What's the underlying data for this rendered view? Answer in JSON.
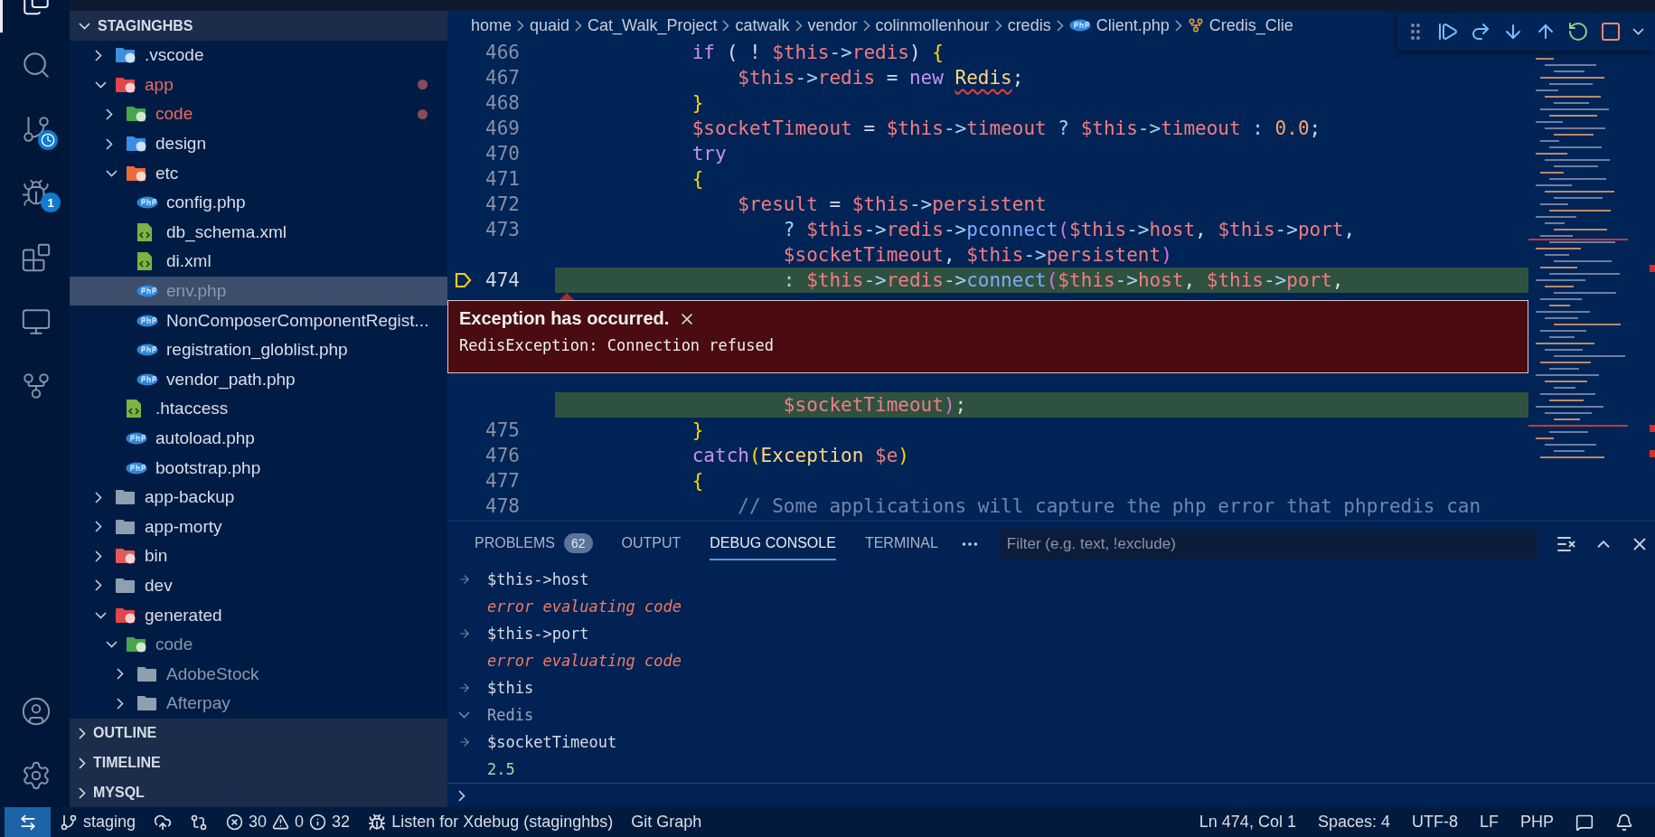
{
  "activity_bar": {
    "items": [
      {
        "kind": "explorer",
        "selected": true
      },
      {
        "kind": "search",
        "selected": false
      },
      {
        "kind": "source-control",
        "selected": false
      },
      {
        "kind": "run-debug",
        "selected": false,
        "badge": "1"
      },
      {
        "kind": "extensions",
        "selected": false
      },
      {
        "kind": "remote-explorer",
        "selected": false
      },
      {
        "kind": "git-graph",
        "selected": false
      }
    ],
    "bottom": [
      {
        "kind": "account"
      },
      {
        "kind": "settings"
      }
    ]
  },
  "sidebar": {
    "title": "STAGINGHBS",
    "expanded": true,
    "tree": [
      {
        "name": ".vscode",
        "kind": "folder-vscode",
        "expanded": false,
        "selected": false
      },
      {
        "name": "app",
        "kind": "folder-app",
        "expanded": true,
        "selected": false,
        "modified": true,
        "children": [
          {
            "name": "code",
            "kind": "folder-code",
            "expanded": false,
            "selected": false,
            "modified": true
          },
          {
            "name": "design",
            "kind": "folder-design",
            "expanded": false,
            "selected": false
          },
          {
            "name": "etc",
            "kind": "folder-config",
            "expanded": true,
            "selected": false,
            "children": [
              {
                "name": "config.php",
                "kind": "php",
                "selected": false
              },
              {
                "name": "db_schema.xml",
                "kind": "xml",
                "selected": false
              },
              {
                "name": "di.xml",
                "kind": "xml",
                "selected": false
              },
              {
                "name": "env.php",
                "kind": "php",
                "selected": true,
                "ignored": true
              },
              {
                "name": "NonComposerComponentRegist...",
                "kind": "php",
                "selected": false
              },
              {
                "name": "registration_globlist.php",
                "kind": "php",
                "selected": false
              },
              {
                "name": "vendor_path.php",
                "kind": "php",
                "selected": false
              }
            ]
          },
          {
            "name": ".htaccess",
            "kind": "xml",
            "selected": false
          },
          {
            "name": "autoload.php",
            "kind": "php",
            "selected": false
          },
          {
            "name": "bootstrap.php",
            "kind": "php",
            "selected": false
          }
        ]
      },
      {
        "name": "app-backup",
        "kind": "folder",
        "expanded": false,
        "selected": false
      },
      {
        "name": "app-morty",
        "kind": "folder",
        "expanded": false,
        "selected": false
      },
      {
        "name": "bin",
        "kind": "folder-bin",
        "expanded": false,
        "selected": false
      },
      {
        "name": "dev",
        "kind": "folder",
        "expanded": false,
        "selected": false
      },
      {
        "name": "generated",
        "kind": "folder-generated",
        "expanded": true,
        "selected": false,
        "children": [
          {
            "name": "code",
            "kind": "folder-code",
            "expanded": true,
            "selected": false,
            "ignored": true,
            "children": [
              {
                "name": "AdobeStock",
                "kind": "folder",
                "expanded": false,
                "selected": false,
                "ignored": true
              },
              {
                "name": "Afterpay",
                "kind": "folder",
                "expanded": false,
                "selected": false,
                "ignored": true
              }
            ]
          }
        ]
      }
    ],
    "sections": [
      {
        "title": "OUTLINE",
        "expanded": false
      },
      {
        "title": "TIMELINE",
        "expanded": false
      },
      {
        "title": "MYSQL",
        "expanded": false
      }
    ]
  },
  "editor": {
    "breadcrumbs": [
      {
        "label": "home"
      },
      {
        "label": "quaid"
      },
      {
        "label": "Cat_Walk_Project"
      },
      {
        "label": "catwalk"
      },
      {
        "label": "vendor"
      },
      {
        "label": "colinmollenhour"
      },
      {
        "label": "credis"
      },
      {
        "label": "Client.php",
        "kind": "php"
      },
      {
        "label": "Credis_Clie",
        "kind": "class"
      }
    ],
    "lines": [
      {
        "kind": "code",
        "number": "466",
        "highlighted": false,
        "tokens": [
          {
            "text": "            if",
            "kind": "kw"
          },
          {
            "text": " ( ! ",
            "kind": "plain"
          },
          {
            "text": "$this",
            "kind": "var"
          },
          {
            "text": "->",
            "kind": "op"
          },
          {
            "text": "redis",
            "kind": "var"
          },
          {
            "text": ") ",
            "kind": "plain"
          },
          {
            "text": "{",
            "kind": "bracket"
          }
        ]
      },
      {
        "kind": "code",
        "number": "467",
        "highlighted": false,
        "tokens": [
          {
            "text": "                $this",
            "kind": "var"
          },
          {
            "text": "->",
            "kind": "op"
          },
          {
            "text": "redis",
            "kind": "var"
          },
          {
            "text": " = ",
            "kind": "plain"
          },
          {
            "text": "new ",
            "kind": "kw"
          },
          {
            "text": "Redis",
            "kind": "class-error"
          },
          {
            "text": ";",
            "kind": "plain"
          }
        ]
      },
      {
        "kind": "code",
        "number": "468",
        "highlighted": false,
        "tokens": [
          {
            "text": "            }",
            "kind": "bracket"
          }
        ]
      },
      {
        "kind": "code",
        "number": "469",
        "highlighted": false,
        "tokens": [
          {
            "text": "            $socketTimeout",
            "kind": "var"
          },
          {
            "text": " = ",
            "kind": "plain"
          },
          {
            "text": "$this",
            "kind": "var"
          },
          {
            "text": "->",
            "kind": "op"
          },
          {
            "text": "timeout",
            "kind": "var"
          },
          {
            "text": " ? ",
            "kind": "op"
          },
          {
            "text": "$this",
            "kind": "var"
          },
          {
            "text": "->",
            "kind": "op"
          },
          {
            "text": "timeout",
            "kind": "var"
          },
          {
            "text": " : ",
            "kind": "op"
          },
          {
            "text": "0.0",
            "kind": "num"
          },
          {
            "text": ";",
            "kind": "plain"
          }
        ]
      },
      {
        "kind": "code",
        "number": "470",
        "highlighted": false,
        "tokens": [
          {
            "text": "            try",
            "kind": "kw"
          }
        ]
      },
      {
        "kind": "code",
        "number": "471",
        "highlighted": false,
        "tokens": [
          {
            "text": "            {",
            "kind": "bracket"
          }
        ]
      },
      {
        "kind": "code",
        "number": "472",
        "highlighted": false,
        "tokens": [
          {
            "text": "                $result",
            "kind": "var"
          },
          {
            "text": " = ",
            "kind": "plain"
          },
          {
            "text": "$this",
            "kind": "var"
          },
          {
            "text": "->",
            "kind": "op"
          },
          {
            "text": "persistent",
            "kind": "var"
          }
        ]
      },
      {
        "kind": "code",
        "number": "473",
        "highlighted": false,
        "tokens": [
          {
            "text": "                    ? ",
            "kind": "op"
          },
          {
            "text": "$this",
            "kind": "var"
          },
          {
            "text": "->",
            "kind": "op"
          },
          {
            "text": "redis",
            "kind": "var"
          },
          {
            "text": "->",
            "kind": "op"
          },
          {
            "text": "pconnect",
            "kind": "fn"
          },
          {
            "text": "(",
            "kind": "paren"
          },
          {
            "text": "$this",
            "kind": "var"
          },
          {
            "text": "->",
            "kind": "op"
          },
          {
            "text": "host",
            "kind": "var"
          },
          {
            "text": ", ",
            "kind": "plain"
          },
          {
            "text": "$this",
            "kind": "var"
          },
          {
            "text": "->",
            "kind": "op"
          },
          {
            "text": "port",
            "kind": "var"
          },
          {
            "text": ",",
            "kind": "plain"
          }
        ]
      },
      {
        "kind": "code",
        "highlighted": false,
        "tokens": [
          {
            "text": "                    $socketTimeout",
            "kind": "var"
          },
          {
            "text": ", ",
            "kind": "plain"
          },
          {
            "text": "$this",
            "kind": "var"
          },
          {
            "text": "->",
            "kind": "op"
          },
          {
            "text": "persistent",
            "kind": "var"
          },
          {
            "text": ")",
            "kind": "paren"
          }
        ]
      },
      {
        "kind": "code",
        "number": "474",
        "current": true,
        "highlighted": true,
        "tokens": [
          {
            "text": "                    : ",
            "kind": "op"
          },
          {
            "text": "$this",
            "kind": "var"
          },
          {
            "text": "->",
            "kind": "op"
          },
          {
            "text": "redis",
            "kind": "var"
          },
          {
            "text": "->",
            "kind": "op"
          },
          {
            "text": "connect",
            "kind": "fn"
          },
          {
            "text": "(",
            "kind": "paren"
          },
          {
            "text": "$this",
            "kind": "var"
          },
          {
            "text": "->",
            "kind": "op"
          },
          {
            "text": "host",
            "kind": "var"
          },
          {
            "text": ", ",
            "kind": "plain"
          },
          {
            "text": "$this",
            "kind": "var"
          },
          {
            "text": "->",
            "kind": "op"
          },
          {
            "text": "port",
            "kind": "var"
          },
          {
            "text": ",",
            "kind": "plain"
          }
        ]
      },
      {
        "kind": "exception",
        "title": "Exception has occurred.",
        "message": "RedisException: Connection refused"
      },
      {
        "kind": "code",
        "highlighted": true,
        "tokens": [
          {
            "text": "                    $socketTimeout",
            "kind": "var"
          },
          {
            "text": ")",
            "kind": "paren"
          },
          {
            "text": ";",
            "kind": "plain"
          }
        ]
      },
      {
        "kind": "code",
        "number": "475",
        "highlighted": false,
        "tokens": [
          {
            "text": "            }",
            "kind": "bracket"
          }
        ]
      },
      {
        "kind": "code",
        "number": "476",
        "highlighted": false,
        "tokens": [
          {
            "text": "            catch",
            "kind": "kw"
          },
          {
            "text": "(",
            "kind": "bracket"
          },
          {
            "text": "Exception ",
            "kind": "class"
          },
          {
            "text": "$e",
            "kind": "var"
          },
          {
            "text": ")",
            "kind": "bracket"
          }
        ]
      },
      {
        "kind": "code",
        "number": "477",
        "highlighted": false,
        "tokens": [
          {
            "text": "            {",
            "kind": "bracket"
          }
        ]
      },
      {
        "kind": "code",
        "number": "478",
        "highlighted": false,
        "tokens": [
          {
            "text": "                // Some applications will capture the php error that phpredis can",
            "kind": "comment"
          }
        ]
      }
    ]
  },
  "debug_toolbar": {
    "buttons": [
      {
        "kind": "grip"
      },
      {
        "kind": "continue"
      },
      {
        "kind": "step-over"
      },
      {
        "kind": "step-into"
      },
      {
        "kind": "step-out"
      },
      {
        "kind": "restart"
      },
      {
        "kind": "stop"
      },
      {
        "kind": "caret"
      }
    ]
  },
  "panel": {
    "tabs": [
      {
        "label": "PROBLEMS",
        "selected": false,
        "badge": "62"
      },
      {
        "label": "OUTPUT",
        "selected": false
      },
      {
        "label": "DEBUG CONSOLE",
        "selected": true
      },
      {
        "label": "TERMINAL",
        "selected": false
      }
    ],
    "filter": {
      "placeholder": "Filter (e.g. text, !exclude)"
    },
    "console": [
      {
        "kind": "input",
        "text": "$this->host"
      },
      {
        "kind": "error",
        "text": "error evaluating code"
      },
      {
        "kind": "input",
        "text": "$this->port"
      },
      {
        "kind": "error",
        "text": "error evaluating code"
      },
      {
        "kind": "input",
        "text": "$this"
      },
      {
        "kind": "group",
        "text": "Redis",
        "expanded": true
      },
      {
        "kind": "input",
        "text": "$socketTimeout"
      },
      {
        "kind": "value",
        "text": "2.5"
      }
    ]
  },
  "status_bar": {
    "left": [
      {
        "kind": "remote"
      },
      {
        "kind": "branch",
        "text": "staging"
      },
      {
        "kind": "sync"
      },
      {
        "kind": "compare"
      },
      {
        "kind": "problems",
        "errors": "30",
        "warnings": "0",
        "infos": "32"
      },
      {
        "kind": "debug",
        "text": "Listen for Xdebug (staginghbs)"
      },
      {
        "kind": "text",
        "text": "Git Graph"
      }
    ],
    "right": [
      {
        "kind": "text",
        "text": "Ln 474, Col 1"
      },
      {
        "kind": "text",
        "text": "Spaces: 4"
      },
      {
        "kind": "text",
        "text": "UTF-8"
      },
      {
        "kind": "text",
        "text": "LF"
      },
      {
        "kind": "text",
        "text": "PHP"
      },
      {
        "kind": "feedback"
      },
      {
        "kind": "bell"
      }
    ]
  }
}
